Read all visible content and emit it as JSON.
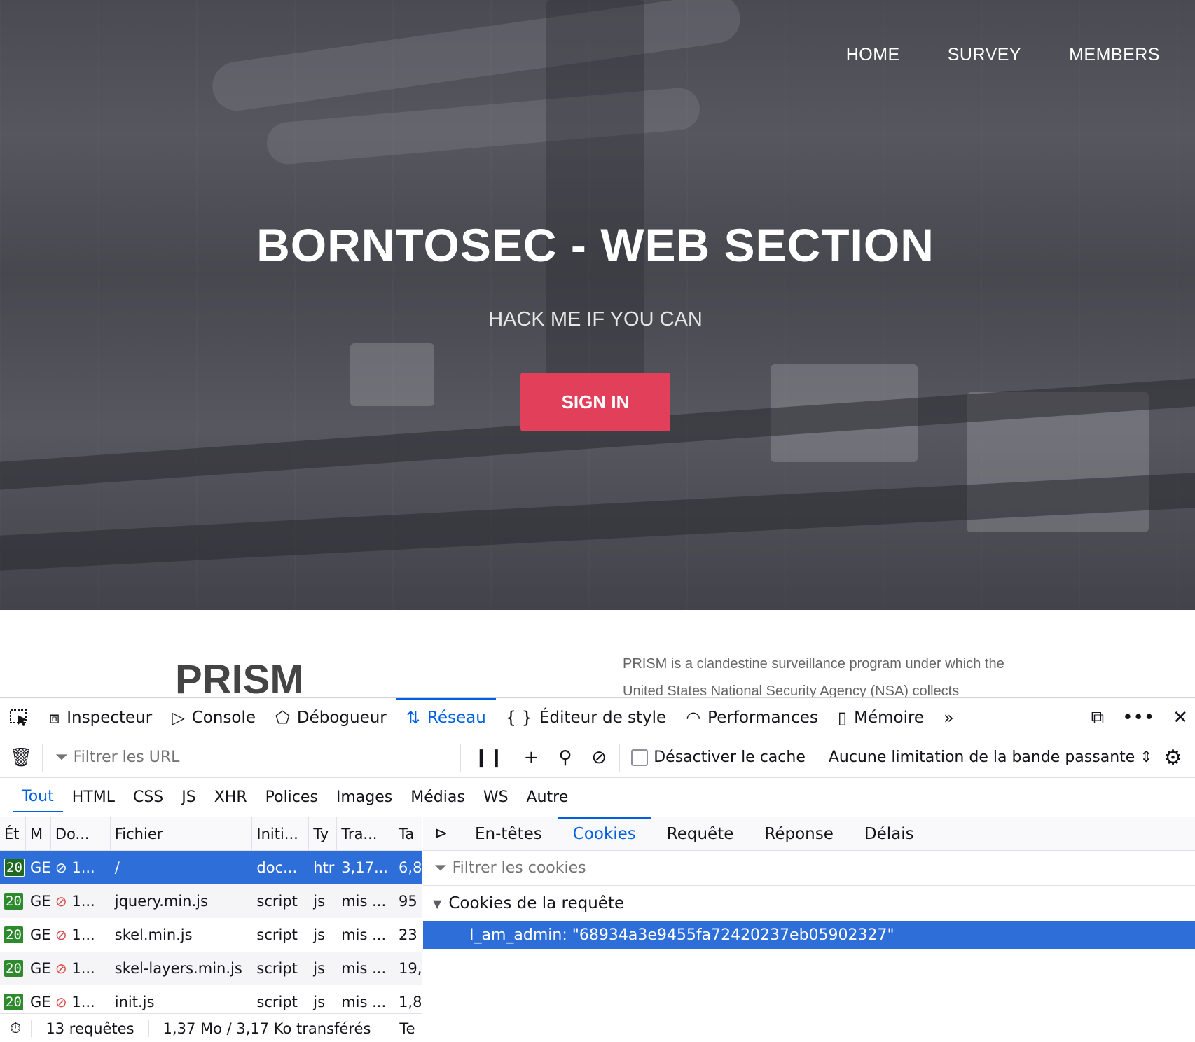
{
  "nav": {
    "home": "HOME",
    "survey": "SURVEY",
    "members": "MEMBERS"
  },
  "hero": {
    "title": "BORNTOSEC - WEB SECTION",
    "subtitle": "HACK ME IF YOU CAN",
    "signin": "SIGN IN"
  },
  "content": {
    "title": "PRISM",
    "text": "PRISM is a clandestine surveillance program under which the United States National Security Agency (NSA) collects"
  },
  "devtools": {
    "tabs": [
      "Inspecteur",
      "Console",
      "Débogueur",
      "Réseau",
      "Éditeur de style",
      "Performances",
      "Mémoire"
    ],
    "filter_placeholder": "Filtrer les URL",
    "disable_cache": "Désactiver le cache",
    "throttle": "Aucune limitation de la bande passante",
    "types": [
      "Tout",
      "HTML",
      "CSS",
      "JS",
      "XHR",
      "Polices",
      "Images",
      "Médias",
      "WS",
      "Autre"
    ],
    "columns": [
      "Ét",
      "M",
      "Do...",
      "Fichier",
      "Initi...",
      "Ty",
      "Tra...",
      "Ta"
    ],
    "requests": [
      {
        "status": "20",
        "method": "GE",
        "domain": "1...",
        "file": "/",
        "initiator": "doc...",
        "type": "htr",
        "transferred": "3,17...",
        "size": "6,8"
      },
      {
        "status": "20",
        "method": "GE",
        "domain": "1...",
        "file": "jquery.min.js",
        "initiator": "script",
        "type": "js",
        "transferred": "mis ...",
        "size": "95"
      },
      {
        "status": "20",
        "method": "GE",
        "domain": "1...",
        "file": "skel.min.js",
        "initiator": "script",
        "type": "js",
        "transferred": "mis ...",
        "size": "23"
      },
      {
        "status": "20",
        "method": "GE",
        "domain": "1...",
        "file": "skel-layers.min.js",
        "initiator": "script",
        "type": "js",
        "transferred": "mis ...",
        "size": "19,"
      },
      {
        "status": "20",
        "method": "GE",
        "domain": "1...",
        "file": "init.js",
        "initiator": "script",
        "type": "js",
        "transferred": "mis ...",
        "size": "1,8"
      }
    ],
    "footer": {
      "count": "13 requêtes",
      "transfer": "1,37 Mo / 3,17 Ko transférés",
      "extra": "Te"
    },
    "side_tabs": [
      "En-têtes",
      "Cookies",
      "Requête",
      "Réponse",
      "Délais"
    ],
    "cookie_filter": "Filtrer les cookies",
    "cookie_group": "Cookies de la requête",
    "cookie": "I_am_admin: \"68934a3e9455fa72420237eb05902327\""
  },
  "colors": {
    "accent": "#0061e0",
    "signin": "#e2405a",
    "selected_row": "#2e6ed8"
  }
}
